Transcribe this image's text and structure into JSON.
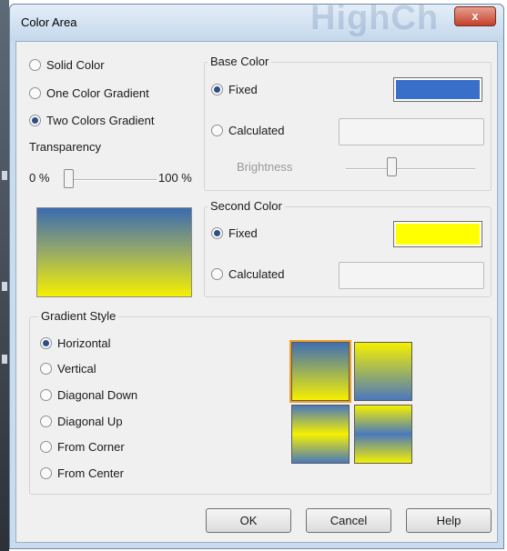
{
  "window": {
    "title": "Color Area",
    "watermark": "HighCh",
    "close_label": "x"
  },
  "fill_type": {
    "options": [
      {
        "label": "Solid Color",
        "selected": false
      },
      {
        "label": "One Color Gradient",
        "selected": false
      },
      {
        "label": "Two Colors Gradient",
        "selected": true
      }
    ]
  },
  "transparency": {
    "label": "Transparency",
    "min_label": "0 %",
    "max_label": "100 %",
    "value_percent": 0
  },
  "base_color": {
    "group_label": "Base Color",
    "fixed_label": "Fixed",
    "calculated_label": "Calculated",
    "selected": "Fixed",
    "brightness_label": "Brightness",
    "color": "#3a6fc9"
  },
  "second_color": {
    "group_label": "Second Color",
    "fixed_label": "Fixed",
    "calculated_label": "Calculated",
    "selected": "Fixed",
    "color": "#ffff00"
  },
  "gradient_style": {
    "group_label": "Gradient Style",
    "options": [
      {
        "label": "Horizontal",
        "selected": true
      },
      {
        "label": "Vertical",
        "selected": false
      },
      {
        "label": "Diagonal Down",
        "selected": false
      },
      {
        "label": "Diagonal Up",
        "selected": false
      },
      {
        "label": "From Corner",
        "selected": false
      },
      {
        "label": "From Center",
        "selected": false
      }
    ]
  },
  "buttons": {
    "ok": "OK",
    "cancel": "Cancel",
    "help": "Help"
  }
}
